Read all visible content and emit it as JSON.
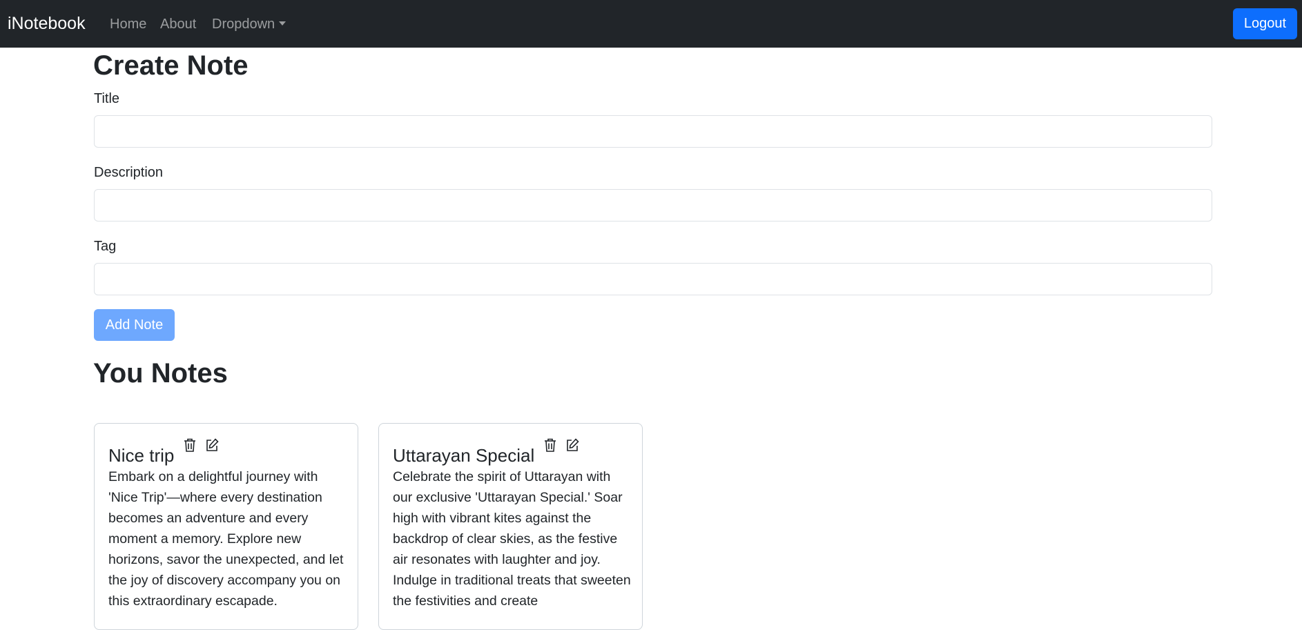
{
  "navbar": {
    "brand": "iNotebook",
    "links": [
      "Home",
      "About",
      "Dropdown"
    ],
    "logout_label": "Logout"
  },
  "form": {
    "heading": "Create Note",
    "title_label": "Title",
    "title_value": "",
    "description_label": "Description",
    "description_value": "",
    "tag_label": "Tag",
    "tag_value": "",
    "submit_label": "Add Note"
  },
  "notes_section": {
    "heading": "You Notes",
    "notes": [
      {
        "title": "Nice trip",
        "description": "Embark on a delightful journey with 'Nice Trip'—where every destination becomes an adventure and every moment a memory. Explore new horizons, savor the unexpected, and let the joy of discovery accompany you on this extraordinary escapade."
      },
      {
        "title": "Uttarayan Special",
        "description": "Celebrate the spirit of Uttarayan with our exclusive 'Uttarayan Special.' Soar high with vibrant kites against the backdrop of clear skies, as the festive air resonates with laughter and joy. Indulge in traditional treats that sweeten the festivities and create"
      }
    ]
  },
  "icons": {
    "delete": "trash-icon",
    "edit": "edit-icon"
  },
  "colors": {
    "navbar_bg": "#212529",
    "primary": "#0d6efd",
    "primary_disabled": "#6ea8fe"
  }
}
